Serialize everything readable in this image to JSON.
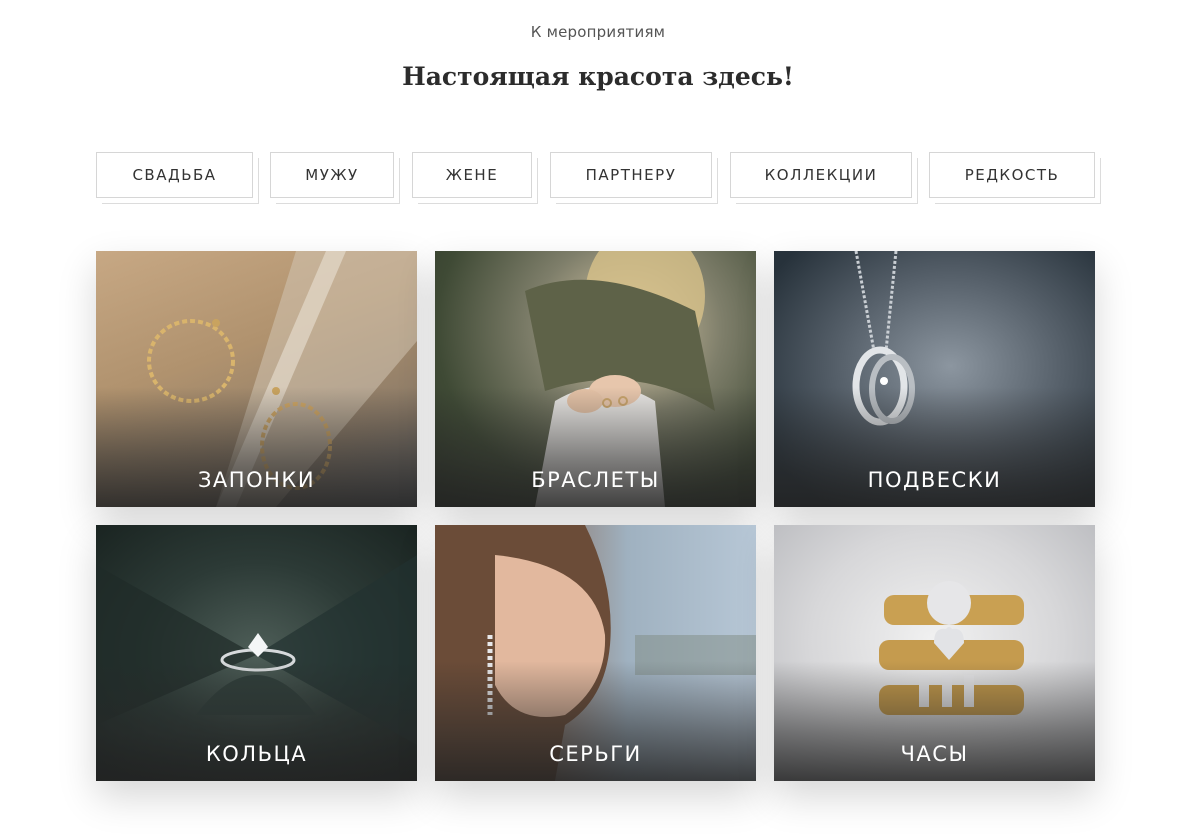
{
  "header": {
    "kicker": "К мероприятиям",
    "title": "Настоящая красота здесь!"
  },
  "filters": [
    {
      "label": "СВАДЬБА"
    },
    {
      "label": "МУЖУ"
    },
    {
      "label": "ЖЕНЕ"
    },
    {
      "label": "ПАРТНЕРУ"
    },
    {
      "label": "КОЛЛЕКЦИИ"
    },
    {
      "label": "РЕДКОСТЬ"
    }
  ],
  "categories": [
    {
      "label": "ЗАПОНКИ",
      "image": "hoop-earrings-photo"
    },
    {
      "label": "БРАСЛЕТЫ",
      "image": "woman-hands-rings-photo"
    },
    {
      "label": "ПОДВЕСКИ",
      "image": "ring-pendant-necklace-photo"
    },
    {
      "label": "КОЛЬЦА",
      "image": "diamond-ring-photo"
    },
    {
      "label": "СЕРЬГИ",
      "image": "woman-drop-earring-photo"
    },
    {
      "label": "ЧАСЫ",
      "image": "gold-diamond-rings-photo"
    }
  ]
}
